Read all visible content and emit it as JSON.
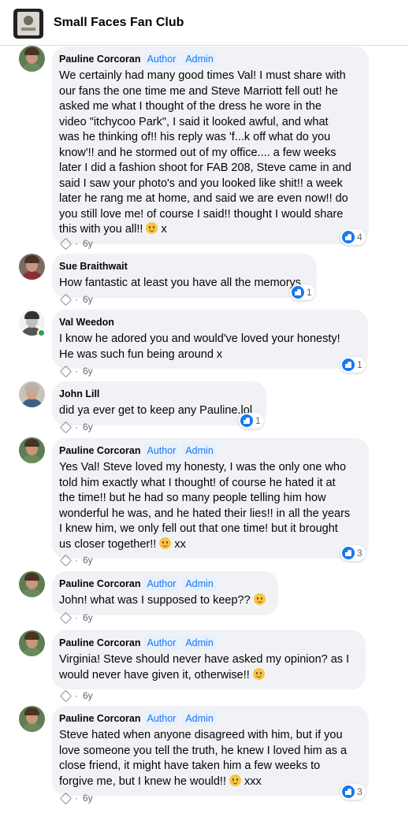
{
  "header": {
    "title": "Small Faces Fan Club"
  },
  "comments": [
    {
      "author": "Pauline Corcoran",
      "badges": [
        "Author",
        "Admin"
      ],
      "lines": [
        "We certainly had many good times Val! I must share with",
        "our fans the one time me and Steve Marriott fell out! he",
        "asked me what I thought of the dress he wore in the",
        "video \"itchycoo Park\", I said it looked awful, and what",
        "was he thinking of!! his reply was 'f...k off what do you",
        "know'!! and he stormed out of my office.... a few weeks",
        "later I did a fashion shoot for FAB 208, Steve came in and",
        "said I saw your photo's and you looked like shit!! a week",
        "later he rang me at home, and said we are even now!! do",
        "you still love me! of course I said!! thought I would share",
        "this with you all!!"
      ],
      "end": "x",
      "time": "6y",
      "reactions": "4"
    },
    {
      "author": "Sue Braithwait",
      "badges": [],
      "lines": [
        "How fantastic at least you have all the memorys"
      ],
      "end": "",
      "time": "6y",
      "reactions": "1"
    },
    {
      "author": "Val Weedon",
      "badges": [],
      "lines": [
        "I know he adored you and would've loved your honesty!",
        "He was such fun being around x"
      ],
      "end": "",
      "time": "6y",
      "reactions": "1"
    },
    {
      "author": "John Lill",
      "badges": [],
      "lines": [
        "did ya ever get to keep any Pauline.lol"
      ],
      "end": "",
      "time": "6y",
      "reactions": "1"
    },
    {
      "author": "Pauline Corcoran",
      "badges": [
        "Author",
        "Admin"
      ],
      "lines": [
        "Yes Val! Steve loved my honesty, I was the only one who",
        "told him exactly what I thought! of course he hated it at",
        "the time!! but he had so many people telling him how",
        "wonderful he was, and he hated their lies!! in all the years",
        "I knew him, we only fell out that one time! but it brought",
        "us closer together!!"
      ],
      "end": "xx",
      "time": "6y",
      "reactions": "3"
    },
    {
      "author": "Pauline Corcoran",
      "badges": [
        "Author",
        "Admin"
      ],
      "lines": [
        "John! what was I supposed to keep??"
      ],
      "end": "",
      "time": "6y",
      "reactions": ""
    },
    {
      "author": "Pauline Corcoran",
      "badges": [
        "Author",
        "Admin"
      ],
      "lines": [
        "Virginia! Steve should never have asked my opinion? as I",
        "would never have given it, otherwise!!"
      ],
      "end": "",
      "time": "6y",
      "reactions": ""
    },
    {
      "author": "Pauline Corcoran",
      "badges": [
        "Author",
        "Admin"
      ],
      "lines": [
        "Steve hated when anyone disagreed with him, but if you",
        "love someone you tell the truth, he knew I loved him as a",
        "close friend, it might have taken him a few weeks to",
        "forgive me, but I knew he would!!"
      ],
      "end": "xxx",
      "time": "6y",
      "reactions": "3"
    }
  ],
  "icons": {
    "reaction": "like-icon",
    "emoji": "smiley-emoji-icon",
    "meta": "tag-icon"
  },
  "colors": {
    "bubble": "#f0f2f5",
    "badge_text": "#1877f2",
    "like": "#1877f2",
    "online": "#31a24c"
  }
}
